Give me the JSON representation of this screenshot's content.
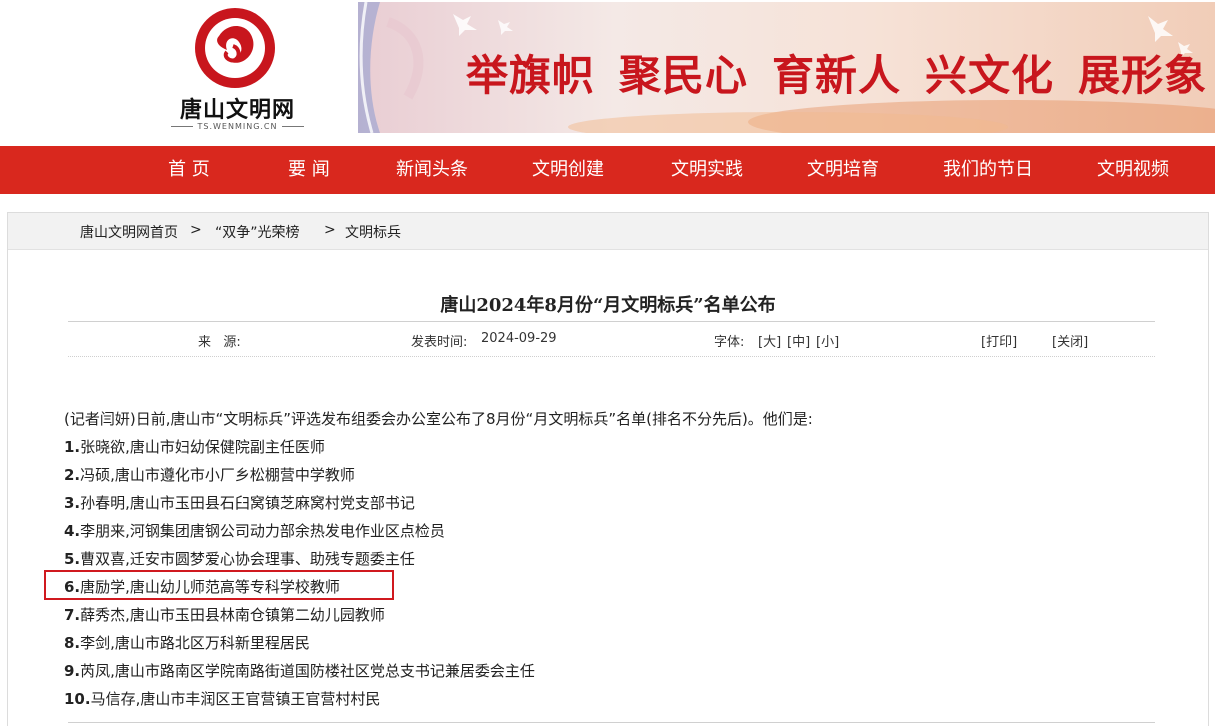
{
  "site": {
    "logo_text": "唐山文明网",
    "logo_sub": "TS.WENMING.CN",
    "banner_slogans": [
      "举旗帜",
      "聚民心",
      "育新人",
      "兴文化",
      "展形象"
    ],
    "colors": {
      "brand_red": "#d9281e",
      "logo_red": "#c8161d"
    }
  },
  "nav": {
    "items": [
      "首 页",
      "要 闻",
      "新闻头条",
      "文明创建",
      "文明实践",
      "文明培育",
      "我们的节日",
      "文明视频"
    ]
  },
  "breadcrumb": {
    "items": [
      "唐山文明网首页",
      "“双争”光荣榜",
      "文明标兵"
    ],
    "separator": ">"
  },
  "article": {
    "title": "唐山2024年8月份“月文明标兵”名单公布",
    "source_label": "来   源:",
    "publish_label": "发表时间:",
    "publish_date": "2024-09-29",
    "font_label": "字体:",
    "font_large": "[大]",
    "font_medium": "[中]",
    "font_small": "[小]",
    "print": "[打印]",
    "close": "[关闭]",
    "intro": "(记者闫妍)日前,唐山市“文明标兵”评选发布组委会办公室公布了8月份“月文明标兵”名单(排名不分先后)。他们是:",
    "list": [
      {
        "num": "1.",
        "text": "张晓欲,唐山市妇幼保健院副主任医师"
      },
      {
        "num": "2.",
        "text": "冯硕,唐山市遵化市小厂乡松棚营中学教师"
      },
      {
        "num": "3.",
        "text": "孙春明,唐山市玉田县石臼窝镇芝麻窝村党支部书记"
      },
      {
        "num": "4.",
        "text": "李朋来,河钢集团唐钢公司动力部余热发电作业区点检员"
      },
      {
        "num": "5.",
        "text": "曹双喜,迁安市圆梦爱心协会理事、助残专题委主任"
      },
      {
        "num": "6.",
        "text": "唐励学,唐山幼儿师范高等专科学校教师"
      },
      {
        "num": "7.",
        "text": "薛秀杰,唐山市玉田县林南仓镇第二幼儿园教师"
      },
      {
        "num": "8.",
        "text": "李剑,唐山市路北区万科新里程居民"
      },
      {
        "num": "9.",
        "text": "芮凤,唐山市路南区学院南路街道国防楼社区党总支书记兼居委会主任"
      },
      {
        "num": "10.",
        "text": "马信存,唐山市丰润区王官营镇王官营村村民"
      }
    ]
  }
}
